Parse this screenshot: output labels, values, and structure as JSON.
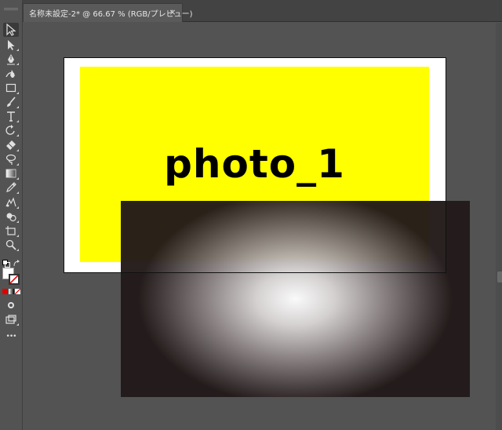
{
  "document_tab": {
    "title": "名称未設定-2* @ 66.67 % (RGB/プレビュー)",
    "close_glyph": "×"
  },
  "artwork": {
    "label_text": "photo_1",
    "yellow_color": "#ffff00",
    "gradient_inner": "#ffffff",
    "gradient_outer": "#231a1a"
  },
  "toolbar": {
    "more_tools_glyph": "•••",
    "tools": [
      {
        "name": "selection-tool-icon"
      },
      {
        "name": "direct-selection-tool-icon"
      },
      {
        "name": "pen-tool-icon"
      },
      {
        "name": "curvature-tool-icon"
      },
      {
        "name": "rectangle-tool-icon"
      },
      {
        "name": "paintbrush-tool-icon"
      },
      {
        "name": "type-tool-icon"
      },
      {
        "name": "rotate-tool-icon"
      },
      {
        "name": "eraser-tool-icon"
      },
      {
        "name": "lasso-tool-icon"
      },
      {
        "name": "gradient-tool-icon"
      },
      {
        "name": "eyedropper-tool-icon"
      },
      {
        "name": "blend-tool-icon"
      },
      {
        "name": "shape-builder-tool-icon"
      },
      {
        "name": "artboard-tool-icon"
      },
      {
        "name": "zoom-tool-icon"
      }
    ]
  }
}
